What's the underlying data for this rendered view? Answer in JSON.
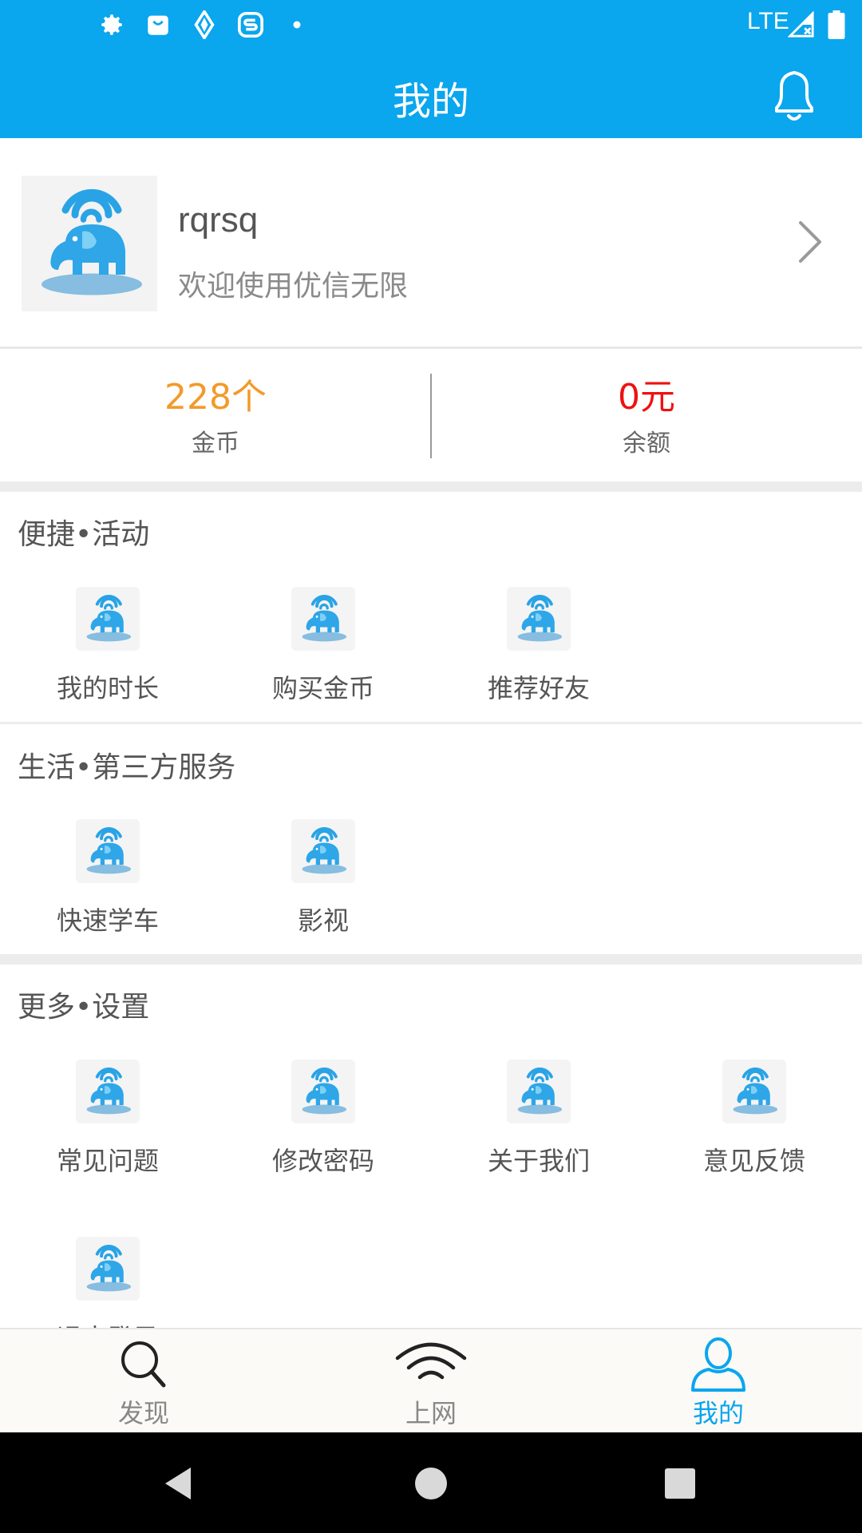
{
  "status_bar": {
    "network": "LTE",
    "icons": [
      "gear-icon",
      "shopping-bag-icon",
      "compass-icon",
      "s-app-icon",
      "dot-icon",
      "signal-icon",
      "battery-icon"
    ]
  },
  "header": {
    "title": "我的",
    "icon": "bell-icon"
  },
  "profile": {
    "username": "rqrsq",
    "subtitle": "欢迎使用优信无限",
    "icon": "chevron-right-icon"
  },
  "stats": {
    "coins": {
      "value": "228个",
      "label": "金币",
      "color": "#f39a2a"
    },
    "balance": {
      "value": "0元",
      "label": "余额",
      "color": "#ee1111"
    }
  },
  "sections": {
    "activities": {
      "title": "便捷•活动",
      "items": [
        {
          "label": "我的时长"
        },
        {
          "label": "购买金币"
        },
        {
          "label": "推荐好友"
        }
      ]
    },
    "services": {
      "title": "生活•第三方服务",
      "items": [
        {
          "label": "快速学车"
        },
        {
          "label": "影视"
        }
      ]
    },
    "settings": {
      "title": "更多•设置",
      "items": [
        {
          "label": "常见问题"
        },
        {
          "label": "修改密码"
        },
        {
          "label": "关于我们"
        },
        {
          "label": "意见反馈"
        },
        {
          "label": "退出登录"
        }
      ]
    }
  },
  "bottom_nav": {
    "items": [
      {
        "label": "发现",
        "icon": "search-icon"
      },
      {
        "label": "上网",
        "icon": "wifi-icon"
      },
      {
        "label": "我的",
        "icon": "user-icon",
        "active": true
      }
    ],
    "active_color": "#0aa6ee",
    "inactive_color": "#888888"
  },
  "system_nav": {
    "icons": [
      "back-icon",
      "home-icon",
      "recents-icon"
    ]
  },
  "colors": {
    "primary": "#0aa6ee"
  }
}
